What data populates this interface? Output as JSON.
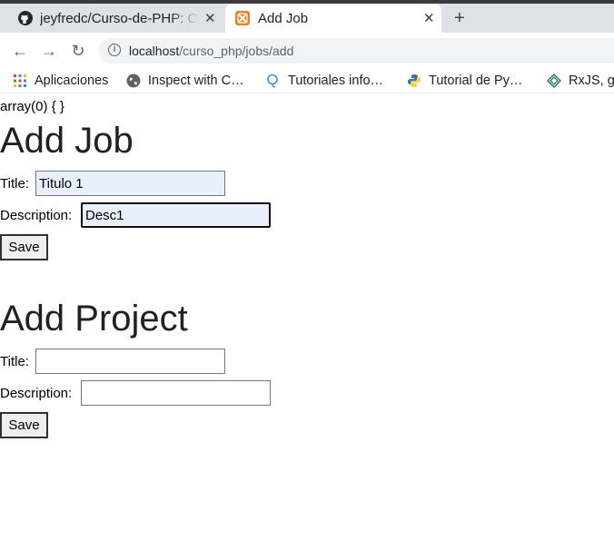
{
  "browser": {
    "tabs": [
      {
        "title": "jeyfredc/Curso-de-PHP: Cu",
        "icon": "github-icon"
      },
      {
        "title": "Add Job",
        "icon": "xampp-icon"
      }
    ],
    "url_host": "localhost",
    "url_path": "/curso_php/jobs/add",
    "bookmarks": [
      {
        "label": "Aplicaciones",
        "icon": "apps-grid-icon"
      },
      {
        "label": "Inspect with C…",
        "icon": "globe-icon"
      },
      {
        "label": "Tutoriales info…",
        "icon": "tutorial-icon"
      },
      {
        "label": "Tutorial de Py…",
        "icon": "python-icon"
      },
      {
        "label": "RxJS, ge",
        "icon": "rxjs-icon"
      }
    ]
  },
  "page": {
    "dump_text": "array(0) { }",
    "job_form": {
      "heading": "Add Job",
      "title_label": "Title:",
      "title_value": "Titulo 1",
      "description_label": "Description:",
      "description_value": "Desc1",
      "save_label": "Save"
    },
    "project_form": {
      "heading": "Add Project",
      "title_label": "Title:",
      "title_value": "",
      "description_label": "Description:",
      "description_value": "",
      "save_label": "Save"
    }
  }
}
